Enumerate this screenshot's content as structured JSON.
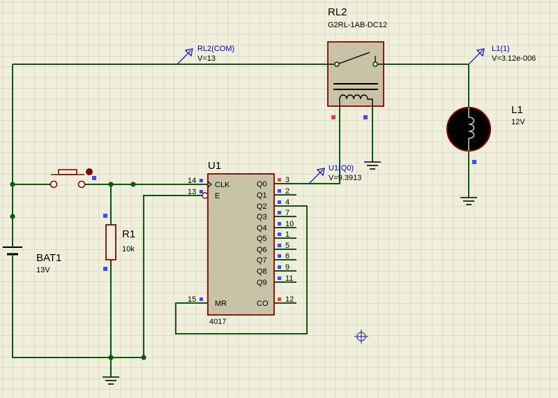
{
  "colors": {
    "background": "#efefdb",
    "grid": "#c9c9b8",
    "wire": "#0b5a0b",
    "component_body": "#c8c2a6",
    "component_outline": "#8b0000",
    "probe_text": "#0000cc",
    "pin_low": "#3b4bff",
    "pin_high": "#ff3b3b"
  },
  "components": {
    "relay": {
      "ref": "RL2",
      "value": "G2RL-1AB-DC12"
    },
    "lamp": {
      "ref": "L1",
      "value": "12V"
    },
    "resistor": {
      "ref": "R1",
      "value": "10k"
    },
    "battery": {
      "ref": "BAT1",
      "value": "13V"
    },
    "counter": {
      "ref": "U1",
      "part": "4017",
      "left_pins": [
        {
          "num": "14",
          "name": "CLK"
        },
        {
          "num": "13",
          "name": "E"
        },
        {
          "num": "15",
          "name": "MR"
        }
      ],
      "right_pins": [
        {
          "num": "3",
          "name": "Q0"
        },
        {
          "num": "2",
          "name": "Q1"
        },
        {
          "num": "4",
          "name": "Q2"
        },
        {
          "num": "7",
          "name": "Q3"
        },
        {
          "num": "10",
          "name": "Q4"
        },
        {
          "num": "1",
          "name": "Q5"
        },
        {
          "num": "5",
          "name": "Q6"
        },
        {
          "num": "6",
          "name": "Q7"
        },
        {
          "num": "9",
          "name": "Q8"
        },
        {
          "num": "11",
          "name": "Q9"
        },
        {
          "num": "12",
          "name": "CO"
        }
      ]
    }
  },
  "probes": [
    {
      "label": "RL2(COM)",
      "value": "V=13"
    },
    {
      "label": "L1(1)",
      "value": "V=3.12e-006"
    },
    {
      "label": "U1(Q0)",
      "value": "V=9.3913"
    }
  ]
}
